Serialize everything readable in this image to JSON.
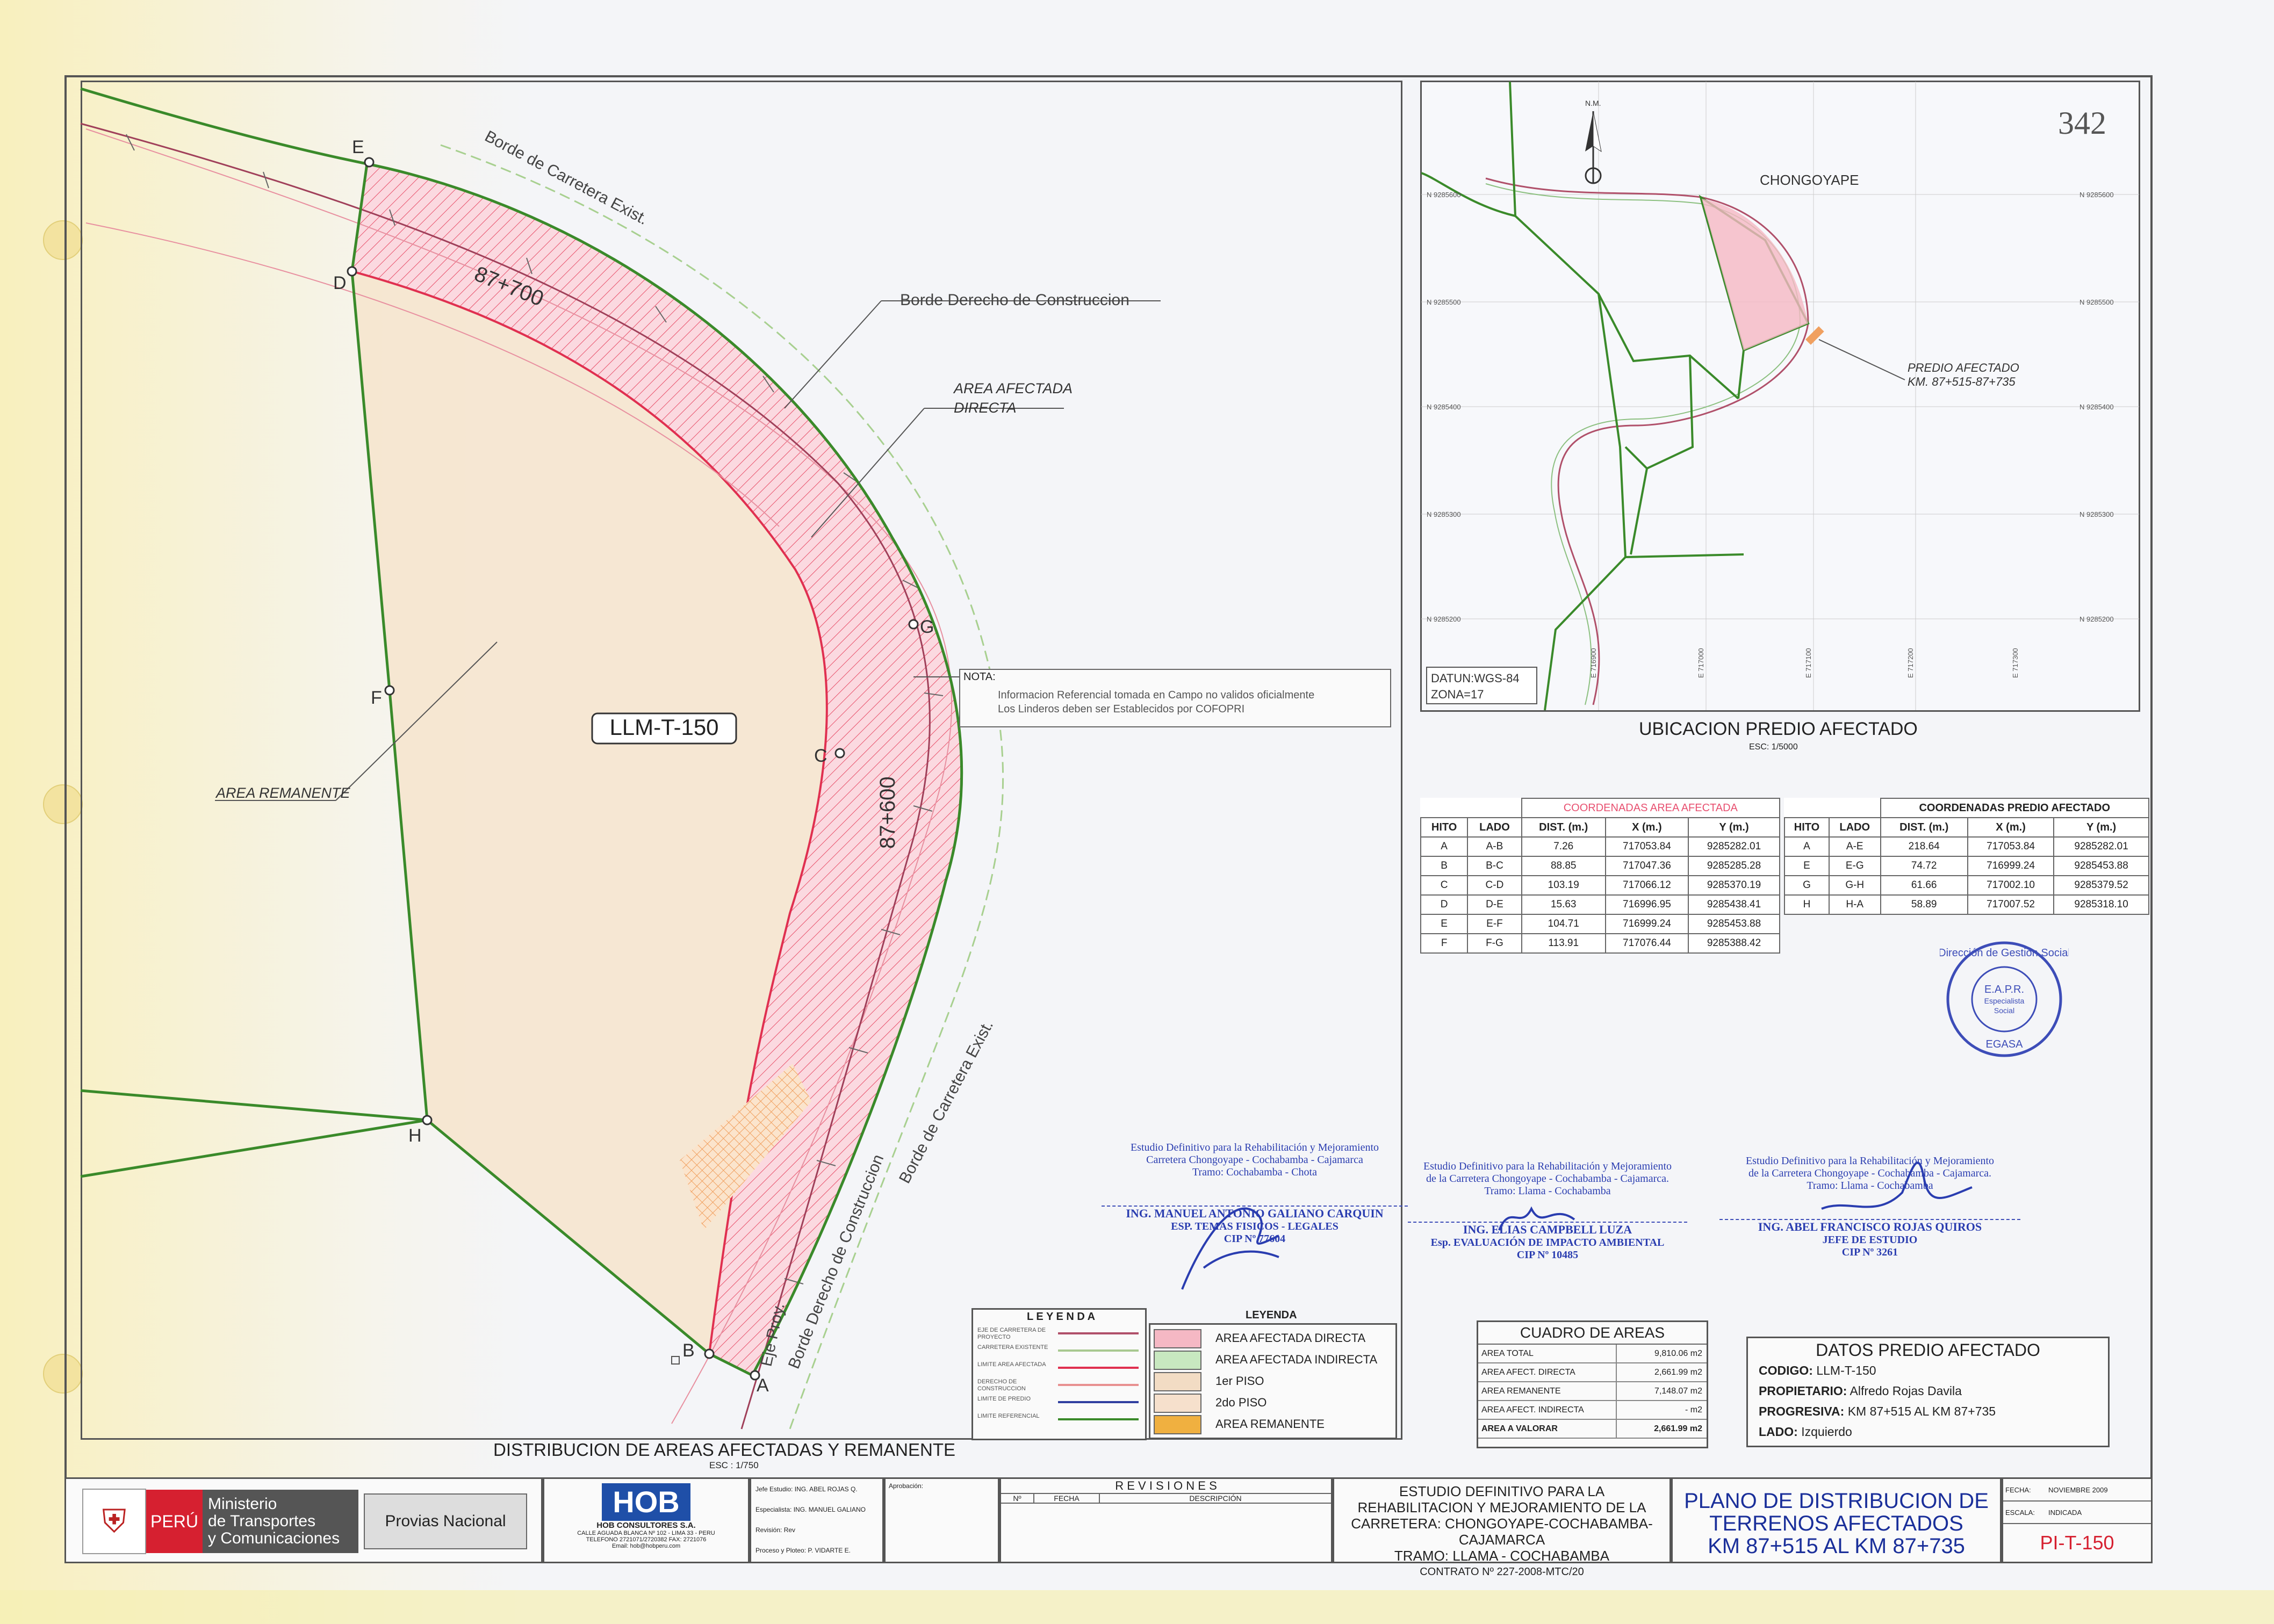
{
  "sheet": {
    "page_number": "342",
    "main_view_title": "DISTRIBUCION DE AREAS AFECTADAS Y REMANENTE",
    "main_view_scale": "ESC : 1/750",
    "parcel_code": "LLM-T-150"
  },
  "map_labels": {
    "point_labels": [
      "A",
      "B",
      "C",
      "D",
      "E",
      "F",
      "G",
      "H"
    ],
    "borde_existente_top": "Borde de Carretera Exist.",
    "borde_existente_bottom": "Borde de Carretera Exist.",
    "borde_derecho": "Borde Derecho de Construccion",
    "borde_derecho_bottom": "Borde Derecho de Construccion",
    "area_afectada_line1": "AREA AFECTADA",
    "area_afectada_line2": "DIRECTA",
    "area_remanente": "AREA REMANENTE",
    "km_700": "87+700",
    "km_600": "87+600",
    "eje_proy": "Eje Proy."
  },
  "nota": {
    "title": "NOTA:",
    "line1": "Informacion Referencial tomada en Campo no validos oficialmente",
    "line2": "Los Linderos deben ser Establecidos por COFOPRI"
  },
  "location_map": {
    "north_label": "N.M.",
    "place_name": "CHONGOYAPE",
    "predio_label_1": "PREDIO AFECTADO",
    "predio_label_2": "KM. 87+515-87+735",
    "datum_1": "DATUN:WGS-84",
    "datum_2": "ZONA=17",
    "title": "UBICACION PREDIO AFECTADO",
    "scale": "ESC: 1/5000",
    "east_ticks": [
      "E 716900",
      "E 717000",
      "E 717100",
      "E 717200",
      "E 717300"
    ],
    "north_ticks": [
      "N 9285600",
      "N 9285500",
      "N 9285400",
      "N 9285300",
      "N 9285200"
    ]
  },
  "coord_afectada": {
    "title": "COORDENADAS AREA AFECTADA",
    "headers": [
      "HITO",
      "LADO",
      "DIST. (m.)",
      "X (m.)",
      "Y (m.)"
    ],
    "rows": [
      [
        "A",
        "A-B",
        "7.26",
        "717053.84",
        "9285282.01"
      ],
      [
        "B",
        "B-C",
        "88.85",
        "717047.36",
        "9285285.28"
      ],
      [
        "C",
        "C-D",
        "103.19",
        "717066.12",
        "9285370.19"
      ],
      [
        "D",
        "D-E",
        "15.63",
        "716996.95",
        "9285438.41"
      ],
      [
        "E",
        "E-F",
        "104.71",
        "716999.24",
        "9285453.88"
      ],
      [
        "F",
        "F-G",
        "113.91",
        "717076.44",
        "9285388.42"
      ]
    ]
  },
  "coord_predio": {
    "title": "COORDENADAS PREDIO AFECTADO",
    "headers": [
      "HITO",
      "LADO",
      "DIST. (m.)",
      "X (m.)",
      "Y (m.)"
    ],
    "rows": [
      [
        "A",
        "A-E",
        "218.64",
        "717053.84",
        "9285282.01"
      ],
      [
        "E",
        "E-G",
        "74.72",
        "716999.24",
        "9285453.88"
      ],
      [
        "G",
        "G-H",
        "61.66",
        "717002.10",
        "9285379.52"
      ],
      [
        "H",
        "H-A",
        "58.89",
        "717007.52",
        "9285318.10"
      ]
    ]
  },
  "seal": {
    "ring_top": "Dirección de Gestión Social",
    "center_1": "E.A.P.R.",
    "center_2": "Especialista",
    "center_3": "Social",
    "bottom": "EGASA"
  },
  "signatures": [
    {
      "line1": "Estudio Definitivo para la Rehabilitación y Mejoramiento",
      "line2": "Carretera Chongoyape - Cochabamba - Cajamarca",
      "line3": "Tramo: Cochabamba - Chota",
      "name": "ING. MANUEL ANTONIO GALIANO CARQUIN",
      "role": "ESP. TEMAS FISICOS - LEGALES",
      "cip": "CIP Nº 77604"
    },
    {
      "line1": "Estudio Definitivo para la Rehabilitación y Mejoramiento",
      "line2": "de la Carretera Chongoyape - Cochabamba - Cajamarca.",
      "line3": "Tramo: Llama - Cochabamba",
      "name": "ING. ELIAS CAMPBELL LUZA",
      "role": "Esp. EVALUACIÓN DE IMPACTO AMBIENTAL",
      "cip": "CIP Nº 10485"
    },
    {
      "line1": "Estudio Definitivo para la Rehabilitación y Mejoramiento",
      "line2": "de la Carretera Chongoyape - Cochabamba - Cajamarca.",
      "line3": "Tramo: Llama - Cochabamba",
      "name": "ING. ABEL FRANCISCO ROJAS QUIROS",
      "role": "JEFE DE ESTUDIO",
      "cip": "CIP Nº 3261"
    }
  ],
  "leyenda_lines": {
    "title": "L E Y E N D A",
    "items": [
      "EJE DE CARRETERA DE PROYECTO",
      "CARRETERA EXISTENTE",
      "LIMITE AREA AFECTADA",
      "DERECHO DE CONSTRUCCION",
      "LIMITE DE PREDIO",
      "LIMITE REFERENCIAL"
    ],
    "colors": [
      "#b0506a",
      "#a8c890",
      "#e03050",
      "#e89090",
      "#3040a0",
      "#3a8a2a"
    ]
  },
  "leyenda_areas": {
    "title": "LEYENDA",
    "items": [
      "AREA AFECTADA DIRECTA",
      "AREA AFECTADA INDIRECTA",
      "1er PISO",
      "2do PISO",
      "AREA REMANENTE"
    ],
    "colors": [
      "#f5b8c4",
      "#c8e8c0",
      "#f2dcc4",
      "#f6e0cc",
      "#f0b040"
    ]
  },
  "cuadro_areas": {
    "title": "CUADRO DE AREAS",
    "rows": [
      [
        "AREA TOTAL",
        "9,810.06 m2"
      ],
      [
        "AREA AFECT. DIRECTA",
        "2,661.99 m2"
      ],
      [
        "AREA REMANENTE",
        "7,148.07 m2"
      ],
      [
        "AREA AFECT. INDIRECTA",
        "- m2"
      ],
      [
        "AREA A VALORAR",
        "2,661.99 m2"
      ]
    ]
  },
  "datos_predio": {
    "title": "DATOS PREDIO AFECTADO",
    "codigo_label": "CODIGO:",
    "codigo": "LLM-T-150",
    "propietario_label": "PROPIETARIO:",
    "propietario": "Alfredo Rojas Davila",
    "progresiva_label": "PROGRESIVA:",
    "progresiva": "KM 87+515 AL KM 87+735",
    "lado_label": "LADO:",
    "lado": "Izquierdo"
  },
  "title_block": {
    "peru": "PERÚ",
    "ministerio_1": "Ministerio",
    "ministerio_2": "de Transportes",
    "ministerio_3": "y Comunicaciones",
    "provias": "Provias Nacional",
    "hob_logo": "HOB",
    "hob_name": "HOB CONSULTORES S.A.",
    "hob_addr_1": "CALLE AGUADA BLANCA Nº 102 - LIMA 33 - PERU",
    "hob_addr_2": "TELEFONO 2721071/2720382 FAX: 2721076",
    "hob_addr_3": "Email: hob@hobperu.com",
    "jefe_label": "Jefe Estudio:",
    "jefe": "ING. ABEL ROJAS Q.",
    "especialista_label": "Especialista:",
    "especialista": "ING. MANUEL GALIANO",
    "revision_label": "Revisión:",
    "revision": "Rev",
    "proceso_label": "Proceso y Ploteo:",
    "proceso": "P. VIDARTE E.",
    "aprobacion_label": "Aprobación:",
    "revisiones_title": "R E V I S I O N E S",
    "rev_headers": [
      "Nº",
      "FECHA",
      "DESCRIPCIÓN"
    ],
    "estudio_1": "ESTUDIO DEFINITIVO PARA LA",
    "estudio_2": "REHABILITACION Y MEJORAMIENTO DE LA",
    "estudio_3": "CARRETERA: CHONGOYAPE-COCHABAMBA-CAJAMARCA",
    "estudio_4": "TRAMO: LLAMA - COCHABAMBA",
    "contrato": "CONTRATO Nº 227-2008-MTC/20",
    "plano_1": "PLANO DE DISTRIBUCION DE",
    "plano_2": "TERRENOS AFECTADOS",
    "plano_3": "KM 87+515 AL KM 87+735",
    "fecha_label": "FECHA:",
    "fecha": "NOVIEMBRE 2009",
    "escala_label": "ESCALA:",
    "escala": "INDICADA",
    "lamina": "PI-T-150"
  }
}
